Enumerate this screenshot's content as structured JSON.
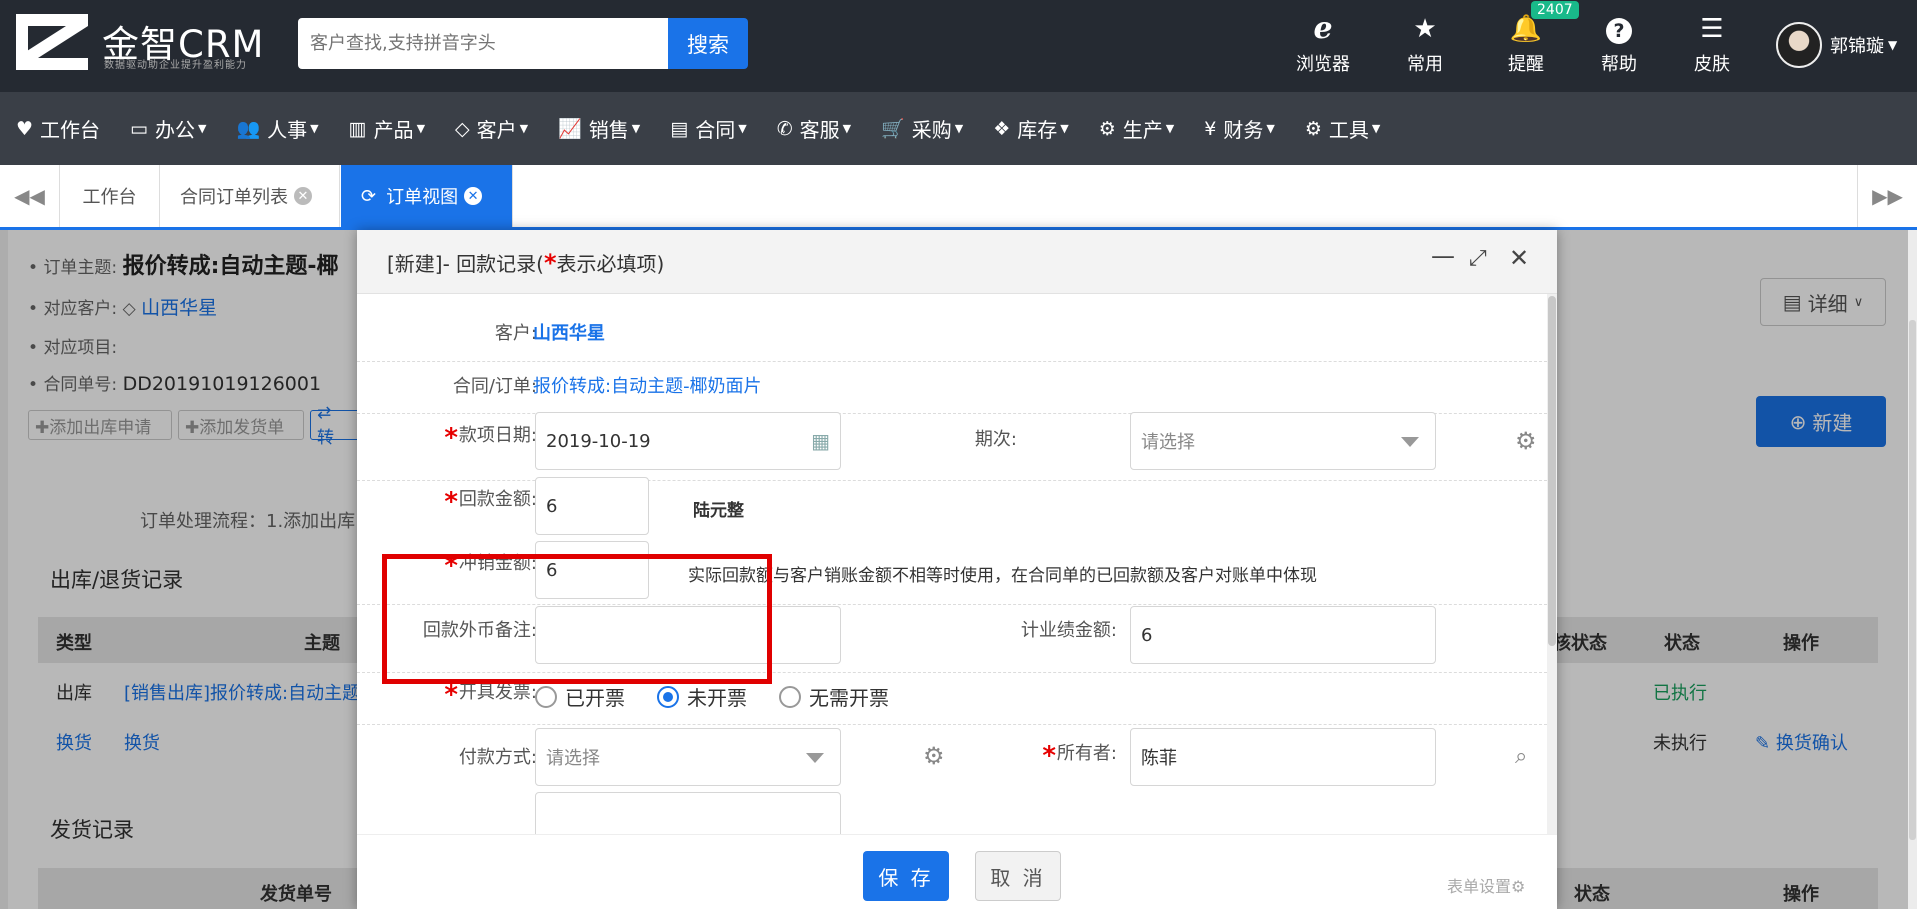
{
  "header": {
    "brand": "金智CRM",
    "brand_sub": "数据驱动助企业提升盈利能力",
    "search_placeholder": "客户查找,支持拼音字头",
    "search_button": "搜索",
    "icons": [
      {
        "label": "浏览器",
        "icon": "ie-browser-icon"
      },
      {
        "label": "常用",
        "icon": "star-icon"
      },
      {
        "label": "提醒",
        "icon": "bell-icon",
        "badge": "2407"
      },
      {
        "label": "帮助",
        "icon": "help-icon"
      },
      {
        "label": "皮肤",
        "icon": "skin-icon"
      }
    ],
    "user_name": "郭锦璇"
  },
  "nav": {
    "items": [
      {
        "label": "工作台",
        "icon": "heart-icon",
        "glyph": "♥"
      },
      {
        "label": "办公",
        "icon": "laptop-icon",
        "glyph": "▭"
      },
      {
        "label": "人事",
        "icon": "users-icon",
        "glyph": "👥"
      },
      {
        "label": "产品",
        "icon": "barcode-icon",
        "glyph": "▥"
      },
      {
        "label": "客户",
        "icon": "diamond-icon",
        "glyph": "◇"
      },
      {
        "label": "销售",
        "icon": "line-chart-icon",
        "glyph": "📈"
      },
      {
        "label": "合同",
        "icon": "newspaper-icon",
        "glyph": "▤"
      },
      {
        "label": "客服",
        "icon": "phone-icon",
        "glyph": "✆"
      },
      {
        "label": "采购",
        "icon": "cart-icon",
        "glyph": "🛒"
      },
      {
        "label": "库存",
        "icon": "cubes-icon",
        "glyph": "❖"
      },
      {
        "label": "生产",
        "icon": "cogs-icon",
        "glyph": "⚙"
      },
      {
        "label": "财务",
        "icon": "yen-icon",
        "glyph": "¥"
      },
      {
        "label": "工具",
        "icon": "gear-icon",
        "glyph": "⚙"
      }
    ]
  },
  "tabs": {
    "items": [
      {
        "label": "工作台"
      },
      {
        "label": "合同订单列表"
      },
      {
        "label": "订单视图"
      }
    ]
  },
  "background": {
    "order_subject_label": "订单主题:",
    "order_subject": "报价转成:自动主题-椰",
    "customer_label": "对应客户:",
    "customer": "山西华星",
    "project_label": "对应项目:",
    "order_no_label": "合同单号:",
    "order_no": "DD20191019126001",
    "btn_add_out": "✚添加出库申请",
    "btn_add_ship": "✚添加发货单",
    "btn_trans": "⇄ 转",
    "detail_btn": "详细",
    "new_btn": "新建",
    "process_text": "订单处理流程：1.添加出库",
    "section1": "出库/退货记录",
    "table1_headers": {
      "type": "类型",
      "subject": "主题",
      "audit": "核状态",
      "status": "状态",
      "op": "操作"
    },
    "table1_rows": [
      {
        "type": "出库",
        "subject": "[销售出库]报价转成:自动主题",
        "status": "已执行",
        "op": ""
      },
      {
        "type": "换货",
        "subject": "换货",
        "status": "未执行",
        "op": "换货确认"
      }
    ],
    "section2": "发货记录",
    "table2_headers": {
      "no": "发货单号",
      "status": "状态",
      "op": "操作"
    }
  },
  "modal": {
    "title_prefix": "[新建]- 回款记录(",
    "title_star": "*",
    "title_suffix": "表示必填项)",
    "fields": {
      "customer_label": "客户:",
      "customer_value": "山西华星",
      "contract_label": "合同/订单:",
      "contract_value": "报价转成:自动主题-椰奶面片",
      "date_label": "款项日期:",
      "date_value": "2019-10-19",
      "period_label": "期次:",
      "period_placeholder": "请选择",
      "amount_label": "回款金额:",
      "amount_value": "6",
      "amount_caps": "陆元整",
      "writeoff_label": "冲销金额:",
      "writeoff_value": "6",
      "writeoff_hint": "实际回款额与客户销账金额不相等时使用，在合同单的已回款额及客户对账单中体现",
      "fx_note_label": "回款外币备注:",
      "fx_note_value": "",
      "perf_label": "计业绩金额:",
      "perf_value": "6",
      "invoice_label": "开具发票:",
      "invoice_options": [
        "已开票",
        "未开票",
        "无需开票"
      ],
      "invoice_selected": "未开票",
      "pay_label": "付款方式:",
      "pay_placeholder": "请选择",
      "owner_label": "所有者:",
      "owner_value": "陈菲"
    },
    "save_button": "保 存",
    "cancel_button": "取 消",
    "form_setting": "表单设置"
  }
}
